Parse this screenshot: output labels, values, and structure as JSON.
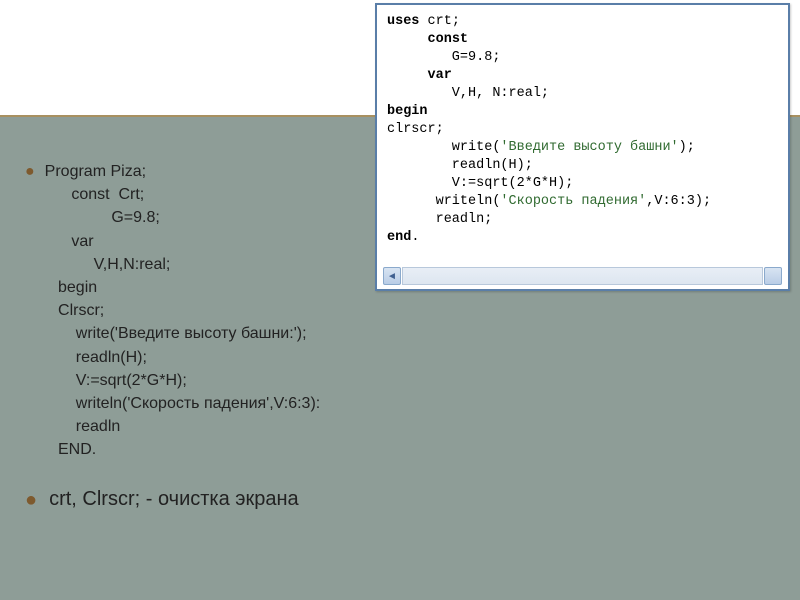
{
  "editor": {
    "lines": [
      {
        "segs": [
          {
            "t": "uses ",
            "c": "kw"
          },
          {
            "t": "crt;",
            "c": ""
          }
        ]
      },
      {
        "segs": [
          {
            "t": "     ",
            "c": ""
          },
          {
            "t": "const",
            "c": "kw"
          }
        ]
      },
      {
        "segs": [
          {
            "t": "        G=9.8;",
            "c": ""
          }
        ]
      },
      {
        "segs": [
          {
            "t": "     ",
            "c": ""
          },
          {
            "t": "var",
            "c": "kw"
          }
        ]
      },
      {
        "segs": [
          {
            "t": "        V,H, N:real;",
            "c": ""
          }
        ]
      },
      {
        "segs": [
          {
            "t": "begin",
            "c": "kw"
          }
        ]
      },
      {
        "segs": [
          {
            "t": "clrscr;",
            "c": ""
          }
        ]
      },
      {
        "segs": [
          {
            "t": "        write(",
            "c": ""
          },
          {
            "t": "'Введите высоту башни'",
            "c": "str"
          },
          {
            "t": ");",
            "c": ""
          }
        ]
      },
      {
        "segs": [
          {
            "t": "        readln(H);",
            "c": ""
          }
        ]
      },
      {
        "segs": [
          {
            "t": "        V:=sqrt(2*G*H);",
            "c": ""
          }
        ]
      },
      {
        "segs": [
          {
            "t": "      writeln(",
            "c": ""
          },
          {
            "t": "'Скорость падения'",
            "c": "str"
          },
          {
            "t": ",V:6:3);",
            "c": ""
          }
        ]
      },
      {
        "segs": [
          {
            "t": "      readln;",
            "c": ""
          }
        ]
      },
      {
        "segs": [
          {
            "t": "end",
            "c": "kw"
          },
          {
            "t": ".",
            "c": ""
          }
        ]
      }
    ],
    "scroll_left": "◄",
    "scroll_right": " "
  },
  "slide": {
    "program_lines": [
      "Program Piza;",
      "      const  Crt;",
      "               G=9.8;",
      "      var",
      "           V,H,N:real;",
      "   begin",
      "   Clrscr;",
      "       write('Введите высоту башни:');",
      "       readln(H);",
      "       V:=sqrt(2*G*H);",
      "       writeln('Скорость падения',V:6:3):",
      "       readln",
      "   END."
    ]
  },
  "footer": {
    "text": "crt, Clrscr; - очистка экрана"
  }
}
